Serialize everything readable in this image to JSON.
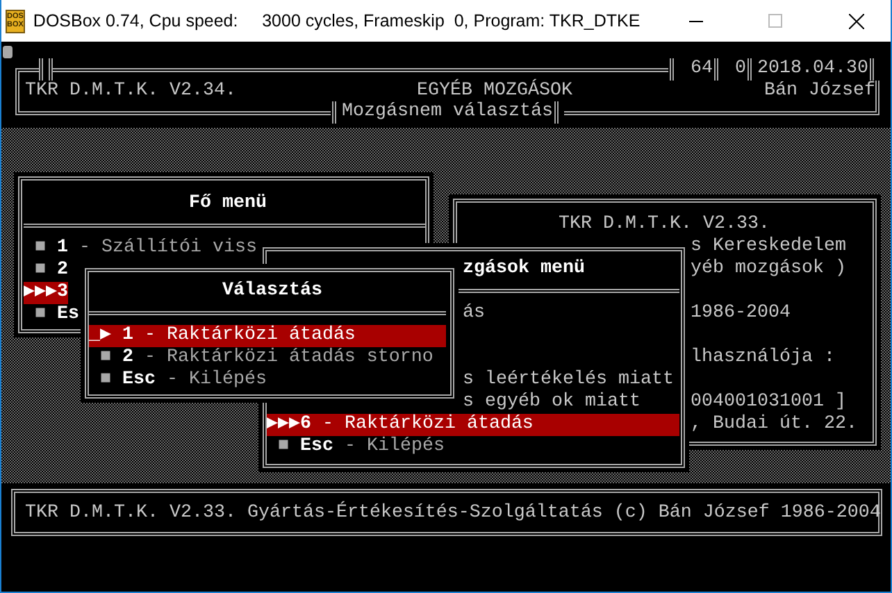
{
  "window": {
    "title": "DOSBox 0.74, Cpu speed:     3000 cycles, Frameskip  0, Program: TKR_DTKE",
    "icon_text": [
      "DOS",
      "BOX"
    ]
  },
  "header": {
    "fields": [
      "64",
      "0",
      "2018.04.30"
    ],
    "program": "TKR D.M.T.K. V2.34.",
    "module": "EGYÉB MOZGÁSOK",
    "user": "Bán József",
    "caption": "Mozgásnem választás"
  },
  "main_menu": {
    "title": "Fő menü",
    "items": [
      {
        "marker": "■",
        "key": "1",
        "label": "- Szállítói viss",
        "selected": false
      },
      {
        "marker": "■",
        "key": "2",
        "selected": false
      },
      {
        "marker": "▶▶▶",
        "key": "3",
        "selected": true
      },
      {
        "marker": "■",
        "key": "Es",
        "selected": false
      }
    ]
  },
  "info_panel": {
    "title": "TKR D.M.T.K. V2.33.",
    "paragraphs": [
      [
        "s Kereskedelem",
        "yéb mozgások )"
      ],
      [
        "1986-2004"
      ],
      [
        "lhasználója :"
      ],
      [
        "004001031001 ]",
        ", Budai út. 22."
      ]
    ]
  },
  "movements_menu": {
    "title": "zgások menü",
    "items": [
      {
        "kind": "partial",
        "label": "ás",
        "selected": false
      },
      {
        "kind": "partial",
        "label": "s leértékelés miatt",
        "selected": false
      },
      {
        "kind": "partial",
        "label": "s egyéb ok miatt",
        "selected": false
      },
      {
        "kind": "full",
        "marker": "▶▶▶",
        "key": "6",
        "label": "- Raktárközi átadás",
        "selected": true
      },
      {
        "kind": "full",
        "marker": "■",
        "key": "Esc",
        "label": "- Kilépés",
        "selected": false
      }
    ]
  },
  "choice_dialog": {
    "title": "Választás",
    "items": [
      {
        "marker": "_▶",
        "key": "1",
        "label": "- Raktárközi átadás",
        "selected": true
      },
      {
        "marker": "■",
        "key": "2",
        "label": "- Raktárközi átadás storno",
        "selected": false
      },
      {
        "marker": "■",
        "key": "Esc",
        "label": "- Kilépés",
        "selected": false
      }
    ]
  },
  "status_bar": {
    "text": "TKR D.M.T.K. V2.33. Gyártás-Értékesítés-Szolgáltatás (c) Bán József 1986-2004"
  }
}
